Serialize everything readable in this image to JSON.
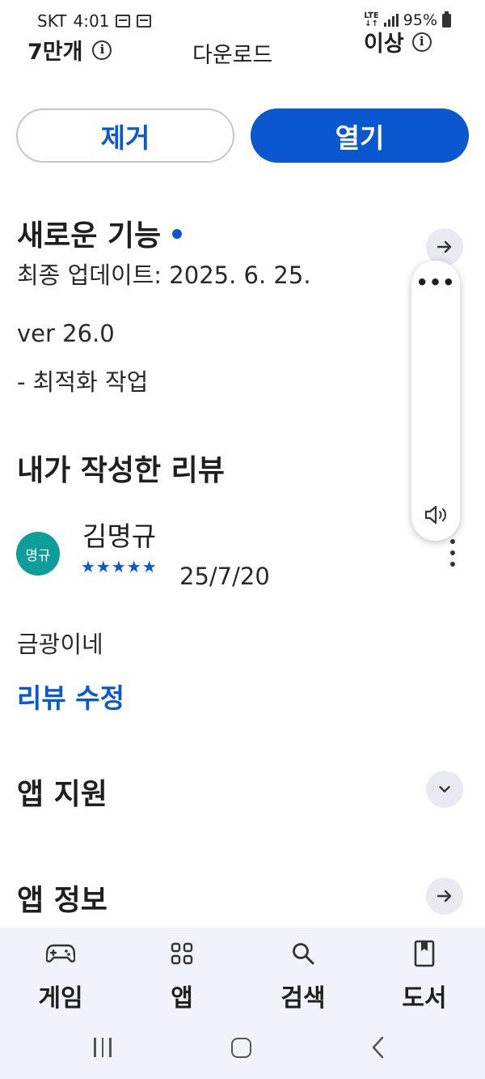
{
  "status_bar": {
    "carrier": "SKT",
    "time": "4:01",
    "network": "LTE",
    "battery": "95%"
  },
  "stats": {
    "downloads_value": "7만개",
    "downloads_label": "다운로드",
    "rating_value": "이상"
  },
  "actions": {
    "remove_label": "제거",
    "open_label": "열기"
  },
  "whats_new": {
    "title": "새로운 기능",
    "last_updated": "최종 업데이트: 2025. 6. 25.",
    "version": "ver 26.0",
    "notes": "- 최적화 작업"
  },
  "my_review": {
    "title": "내가 작성한 리뷰",
    "avatar_text": "명규",
    "reviewer_name": "김명규",
    "rating": 5,
    "stars_text": "★★★★★",
    "date": "25/7/20",
    "body": "금광이네",
    "edit_label": "리뷰 수정"
  },
  "app_support": {
    "title": "앱 지원"
  },
  "app_info": {
    "title": "앱 정보"
  },
  "bottom_nav": {
    "items": [
      {
        "label": "게임",
        "icon": "gamepad-icon"
      },
      {
        "label": "앱",
        "icon": "apps-grid-icon"
      },
      {
        "label": "검색",
        "icon": "search-icon"
      },
      {
        "label": "도서",
        "icon": "book-icon"
      }
    ]
  },
  "colors": {
    "accent": "#0b57d0",
    "avatar": "#0f9d9a",
    "nav_background": "#f0f3f9",
    "circle_button": "#e7eaf1"
  }
}
